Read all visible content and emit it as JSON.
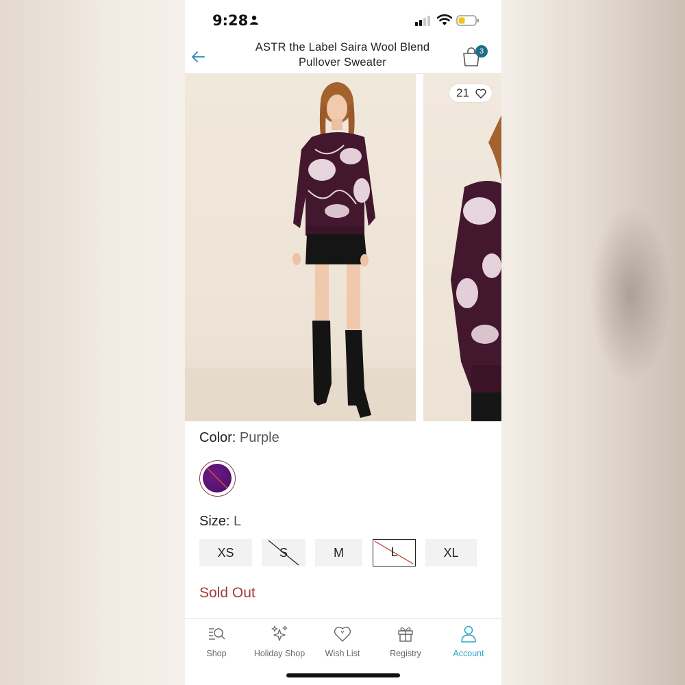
{
  "status_bar": {
    "time": "9:28"
  },
  "header": {
    "title_line1": "ASTR the Label Saira Wool Blend",
    "title_line2": "Pullover Sweater",
    "cart_count": "3"
  },
  "gallery": {
    "like_count": "21"
  },
  "product": {
    "color_label": "Color:",
    "color_value": "Purple",
    "swatch_color": "#5a1474",
    "size_label": "Size:",
    "size_value": "L",
    "sizes": [
      {
        "label": "XS",
        "available": true,
        "selected": false
      },
      {
        "label": "S",
        "available": false,
        "selected": false
      },
      {
        "label": "M",
        "available": true,
        "selected": false
      },
      {
        "label": "L",
        "available": false,
        "selected": true
      },
      {
        "label": "XL",
        "available": true,
        "selected": false
      }
    ],
    "status": "Sold Out"
  },
  "tab_bar": {
    "tabs": [
      {
        "label": "Shop",
        "icon": "shop-search-icon",
        "active": false
      },
      {
        "label": "Holiday Shop",
        "icon": "sparkles-icon",
        "active": false
      },
      {
        "label": "Wish List",
        "icon": "heart-icon",
        "active": false
      },
      {
        "label": "Registry",
        "icon": "gift-icon",
        "active": false
      },
      {
        "label": "Account",
        "icon": "person-icon",
        "active": true
      }
    ]
  },
  "colors": {
    "accent": "#2aa3c8",
    "badge": "#1b6f8a",
    "sold_out": "#a33a3a",
    "strike": "#c0392b"
  }
}
